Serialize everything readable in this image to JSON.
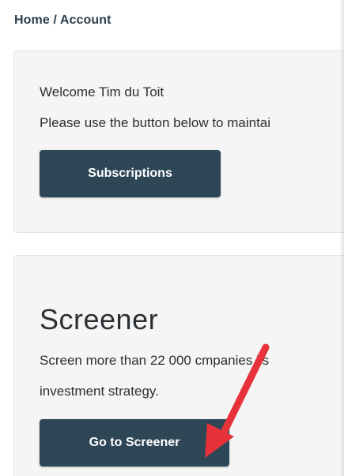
{
  "breadcrumb": {
    "text": "Home / Account"
  },
  "welcome_card": {
    "line1": "Welcome Tim du Toit",
    "line2": "Please use the button below to maintai",
    "subscriptions_label": "Subscriptions"
  },
  "screener_card": {
    "title": "Screener",
    "line1_before": "Screen more than 22 000 c",
    "line1_after": "mpanies lis",
    "line2": "investment strategy.",
    "button_label": "Go to Screener"
  },
  "annotation": {
    "arrow_icon": "red-arrow-icon",
    "arrow_color": "#e8323a"
  },
  "colors": {
    "button_bg": "#2e4757",
    "card_bg": "#f5f5f5",
    "text": "#2b2f33"
  }
}
